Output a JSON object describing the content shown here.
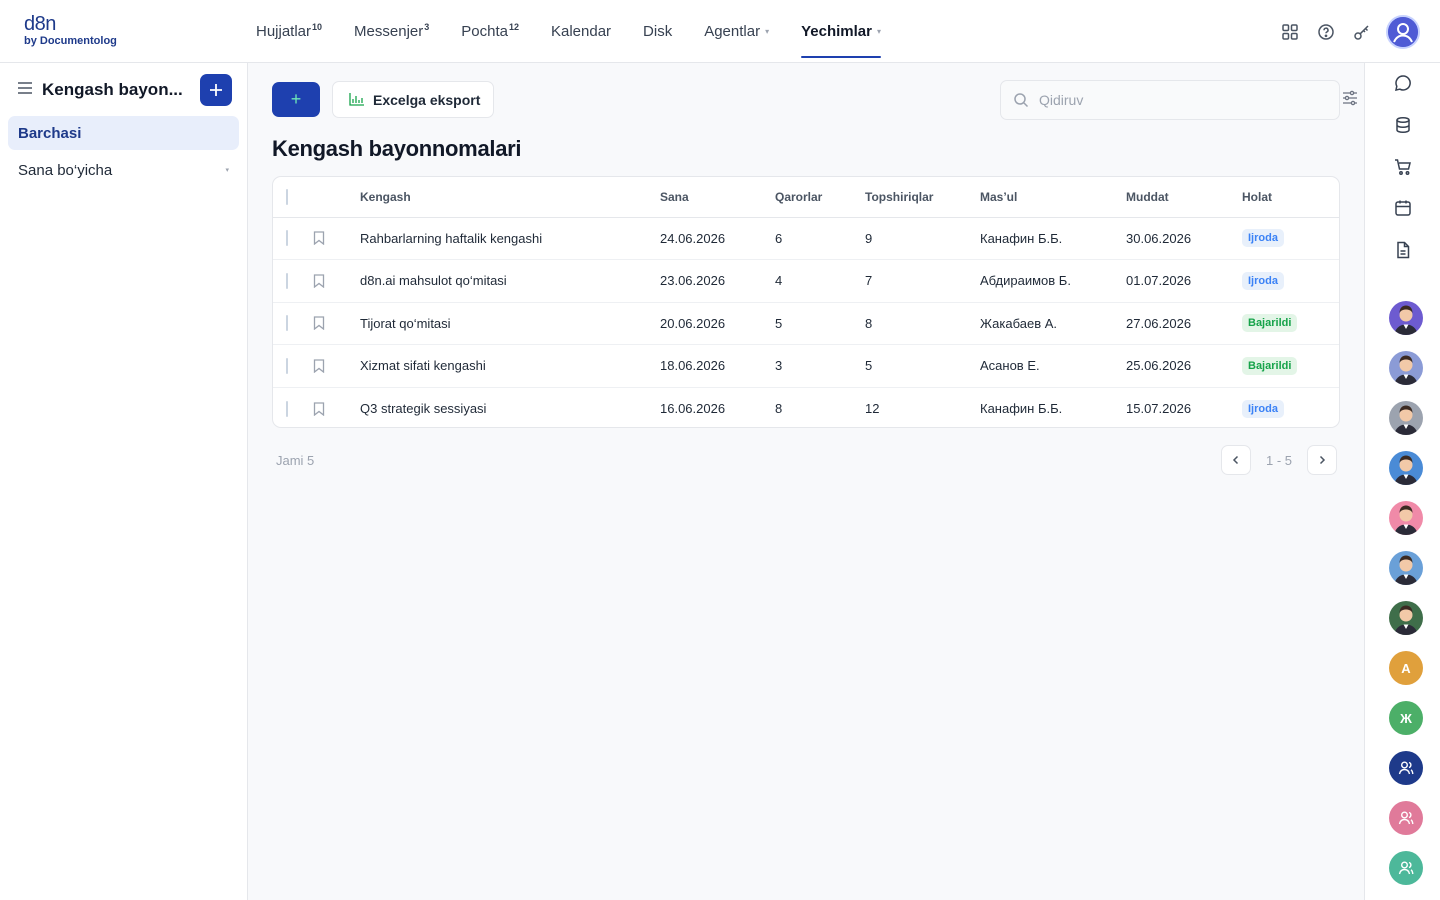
{
  "logo": {
    "line1": "d8n",
    "line2": "by Documentolog"
  },
  "nav": [
    {
      "label": "Hujjatlar",
      "badge": "10"
    },
    {
      "label": "Messenjer",
      "badge": "3"
    },
    {
      "label": "Pochta",
      "badge": "12"
    },
    {
      "label": "Kalendar"
    },
    {
      "label": "Disk"
    },
    {
      "label": "Agentlar",
      "dropdown": true
    },
    {
      "label": "Yechimlar",
      "dropdown": true,
      "active": true
    }
  ],
  "sidebar": {
    "title": "Kengash bayon...",
    "items": [
      {
        "label": "Barchasi",
        "active": true
      },
      {
        "label": "Sana bo‘yicha"
      }
    ]
  },
  "toolbar": {
    "add_label": "+",
    "export_label": "Excelga eksport"
  },
  "search": {
    "placeholder": "Qidiruv"
  },
  "page": {
    "title": "Kengash bayonnomalari"
  },
  "table": {
    "columns": [
      "Kengash",
      "Sana",
      "Qarorlar",
      "Topshiriqlar",
      "Mas’ul",
      "Muddat",
      "Holat"
    ],
    "rows": [
      {
        "name": "Rahbarlarning haftalik kengashi",
        "date": "24.06.2026",
        "decisions": "6",
        "tasks": "9",
        "owner": "Канафин Б.Б.",
        "deadline": "30.06.2026",
        "status": "Ijroda",
        "status_color": "blue"
      },
      {
        "name": "d8n.ai mahsulot qo‘mitasi",
        "date": "23.06.2026",
        "decisions": "4",
        "tasks": "7",
        "owner": "Абдираимов Б.",
        "deadline": "01.07.2026",
        "status": "Ijroda",
        "status_color": "blue"
      },
      {
        "name": "Tijorat qo‘mitasi",
        "date": "20.06.2026",
        "decisions": "5",
        "tasks": "8",
        "owner": "Жакабаев А.",
        "deadline": "27.06.2026",
        "status": "Bajarildi",
        "status_color": "green"
      },
      {
        "name": "Xizmat sifati kengashi",
        "date": "18.06.2026",
        "decisions": "3",
        "tasks": "5",
        "owner": "Асанов Е.",
        "deadline": "25.06.2026",
        "status": "Bajarildi",
        "status_color": "green"
      },
      {
        "name": "Q3 strategik sessiyasi",
        "date": "16.06.2026",
        "decisions": "8",
        "tasks": "12",
        "owner": "Канафин Б.Б.",
        "deadline": "15.07.2026",
        "status": "Ijroda",
        "status_color": "blue"
      }
    ]
  },
  "footer": {
    "total": "Jami 5",
    "range": "1 - 5"
  },
  "rail": {
    "avatars": [
      {
        "kind": "photo",
        "color": "#6d5bd0"
      },
      {
        "kind": "photo",
        "color": "#8b9bd6"
      },
      {
        "kind": "photo",
        "color": "#9ca3af"
      },
      {
        "kind": "photo",
        "color": "#4a8bd6"
      },
      {
        "kind": "photo",
        "color": "#f08aa8"
      },
      {
        "kind": "photo",
        "color": "#6aa0d8"
      },
      {
        "kind": "photo",
        "color": "#3f6e4a"
      },
      {
        "kind": "letter",
        "letter": "A",
        "color": "#e0a03c"
      },
      {
        "kind": "letter",
        "letter": "Ж",
        "color": "#4caf68"
      },
      {
        "kind": "user",
        "color": "#1e3a8a"
      },
      {
        "kind": "user",
        "color": "#e07a9a"
      },
      {
        "kind": "user",
        "color": "#4db89a"
      }
    ]
  }
}
